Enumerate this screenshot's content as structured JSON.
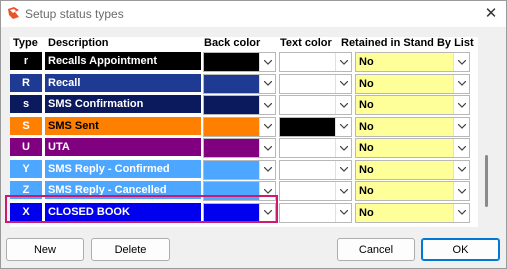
{
  "window": {
    "title": "Setup status types",
    "close_glyph": "✕"
  },
  "headers": {
    "type": "Type",
    "description": "Description",
    "back_color": "Back color",
    "text_color": "Text color",
    "retained": "Retained in Stand By List"
  },
  "rows": [
    {
      "type": "r",
      "description": "Recalls Appointment",
      "type_bg": "#000000",
      "desc_bg": "#000000",
      "desc_fg": "#ffffff",
      "back_color": "#000000",
      "text_color": "#ffffff",
      "retained": "No"
    },
    {
      "type": "R",
      "description": "Recall",
      "type_bg": "#1f3a93",
      "desc_bg": "#1f3a93",
      "desc_fg": "#ffffff",
      "back_color": "#1f3a93",
      "text_color": "#ffffff",
      "retained": "No"
    },
    {
      "type": "s",
      "description": "SMS Confirmation",
      "type_bg": "#0a1a5c",
      "desc_bg": "#0a1a5c",
      "desc_fg": "#ffffff",
      "back_color": "#0a1a5c",
      "text_color": "#ffffff",
      "retained": "No"
    },
    {
      "type": "S",
      "description": "SMS Sent",
      "type_bg": "#ff8000",
      "desc_bg": "#ff8000",
      "desc_fg": "#000000",
      "back_color": "#ff8000",
      "text_color": "#000000",
      "retained": "No"
    },
    {
      "type": "U",
      "description": "UTA",
      "type_bg": "#800080",
      "desc_bg": "#800080",
      "desc_fg": "#ffffff",
      "back_color": "#800080",
      "text_color": "#ffffff",
      "retained": "No"
    },
    {
      "type": "Y",
      "description": "SMS Reply - Confirmed",
      "type_bg": "#4da6ff",
      "desc_bg": "#4da6ff",
      "desc_fg": "#ffffff",
      "back_color": "#4da6ff",
      "text_color": "#ffffff",
      "retained": "No"
    },
    {
      "type": "Z",
      "description": "SMS Reply - Cancelled",
      "type_bg": "#4da6ff",
      "desc_bg": "#4da6ff",
      "desc_fg": "#ffffff",
      "back_color": "#4da6ff",
      "text_color": "#ffffff",
      "retained": "No"
    },
    {
      "type": "X",
      "description": "CLOSED BOOK",
      "type_bg": "#0000ee",
      "desc_bg": "#0000ee",
      "desc_fg": "#ffffff",
      "back_color": "#0000ee",
      "text_color": "#ffffff",
      "retained": "No"
    }
  ],
  "buttons": {
    "new": "New",
    "delete": "Delete",
    "cancel": "Cancel",
    "ok": "OK"
  },
  "colors": {
    "highlight": "#cc1a6e",
    "retained_bg": "#ffff99",
    "ok_border": "#0078d4"
  }
}
